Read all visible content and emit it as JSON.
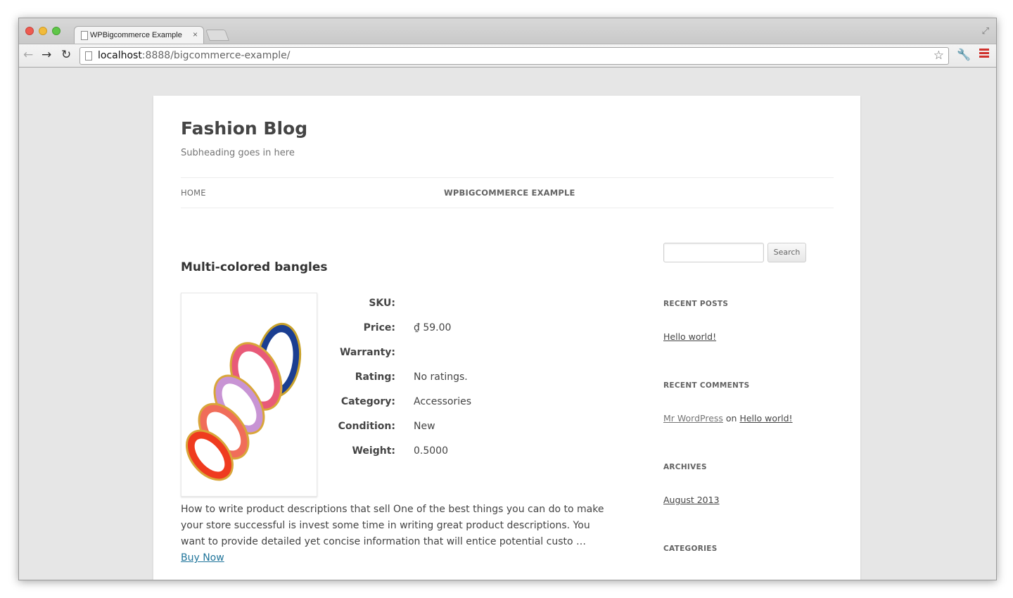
{
  "browser": {
    "tab_title": "WPBigcommerce Example",
    "tab_close": "×",
    "url_host": "localhost",
    "url_rest": ":8888/bigcommerce-example/"
  },
  "site": {
    "title": "Fashion Blog",
    "description": "Subheading goes in here"
  },
  "nav": {
    "home": "HOME",
    "current": "WPBIGCOMMERCE EXAMPLE"
  },
  "product": {
    "title": "Multi-colored bangles",
    "specs": [
      {
        "label": "SKU:",
        "value": ""
      },
      {
        "label": "Price:",
        "value": "₫ 59.00"
      },
      {
        "label": "Warranty:",
        "value": ""
      },
      {
        "label": "Rating:",
        "value": "No ratings."
      },
      {
        "label": "Category:",
        "value": "Accessories"
      },
      {
        "label": "Condition:",
        "value": "New"
      },
      {
        "label": "Weight:",
        "value": "0.5000"
      }
    ],
    "description": "How to write product descriptions that sell One of the best things you can do to make your store successful is invest some time in writing great product descriptions. You want to provide detailed yet concise information that will entice potential custo …",
    "buy_now": "Buy Now"
  },
  "sidebar": {
    "search_button": "Search",
    "recent_posts_title": "RECENT POSTS",
    "recent_post": "Hello world!",
    "recent_comments_title": "RECENT COMMENTS",
    "comment_author": "Mr WordPress",
    "comment_on": " on ",
    "comment_post": "Hello world!",
    "archives_title": "ARCHIVES",
    "archive_item": "August 2013",
    "categories_title": "CATEGORIES"
  }
}
